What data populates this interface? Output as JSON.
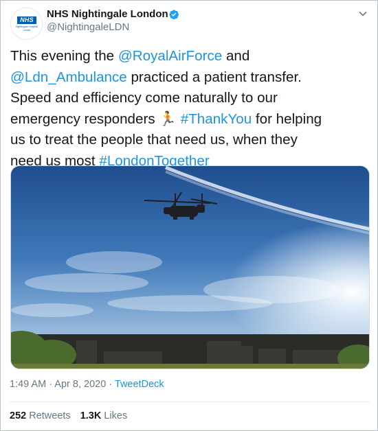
{
  "author": {
    "name": "NHS Nightingale London",
    "handle": "@NightingaleLDN",
    "avatar": {
      "logo_text": "NHS",
      "line1": "Nightingale Hospital",
      "line2": "London"
    },
    "verified_icon": "verified-badge-icon"
  },
  "tweet": {
    "lines": [
      {
        "parts": [
          {
            "text": "This evening the ",
            "link": false
          },
          {
            "text": "@RoyalAirForce",
            "link": true
          },
          {
            "text": " and",
            "link": false
          }
        ]
      },
      {
        "parts": [
          {
            "text": "@Ldn_Ambulance",
            "link": true
          },
          {
            "text": " practiced a patient transfer.",
            "link": false
          }
        ]
      },
      {
        "parts": [
          {
            "text": "Speed and efficiency come naturally to our",
            "link": false
          }
        ]
      },
      {
        "parts": [
          {
            "text": "emergency responders ",
            "link": false
          },
          {
            "text": "🏃",
            "link": false,
            "emoji": true
          },
          {
            "text": " ",
            "link": false
          },
          {
            "text": "#ThankYou",
            "link": true
          },
          {
            "text": " for helping",
            "link": false
          }
        ]
      },
      {
        "parts": [
          {
            "text": "us to treat the people that need us, when they",
            "link": false
          }
        ]
      },
      {
        "parts": [
          {
            "text": "need us most ",
            "link": false
          },
          {
            "text": "#LondonTogether",
            "link": true
          }
        ]
      }
    ]
  },
  "media": {
    "description_icon": "photo-helicopter-sky"
  },
  "meta": {
    "time": "1:49 AM",
    "sep1": " · ",
    "date": "Apr 8, 2020",
    "sep2": " · ",
    "source": "TweetDeck"
  },
  "stats": {
    "retweets_count": "252",
    "retweets_label": "Retweets",
    "likes_count": "1.3K",
    "likes_label": "Likes"
  },
  "colors": {
    "link": "#1b95e0",
    "muted": "#657786",
    "text": "#14171a",
    "nhs_blue": "#005eb8"
  }
}
